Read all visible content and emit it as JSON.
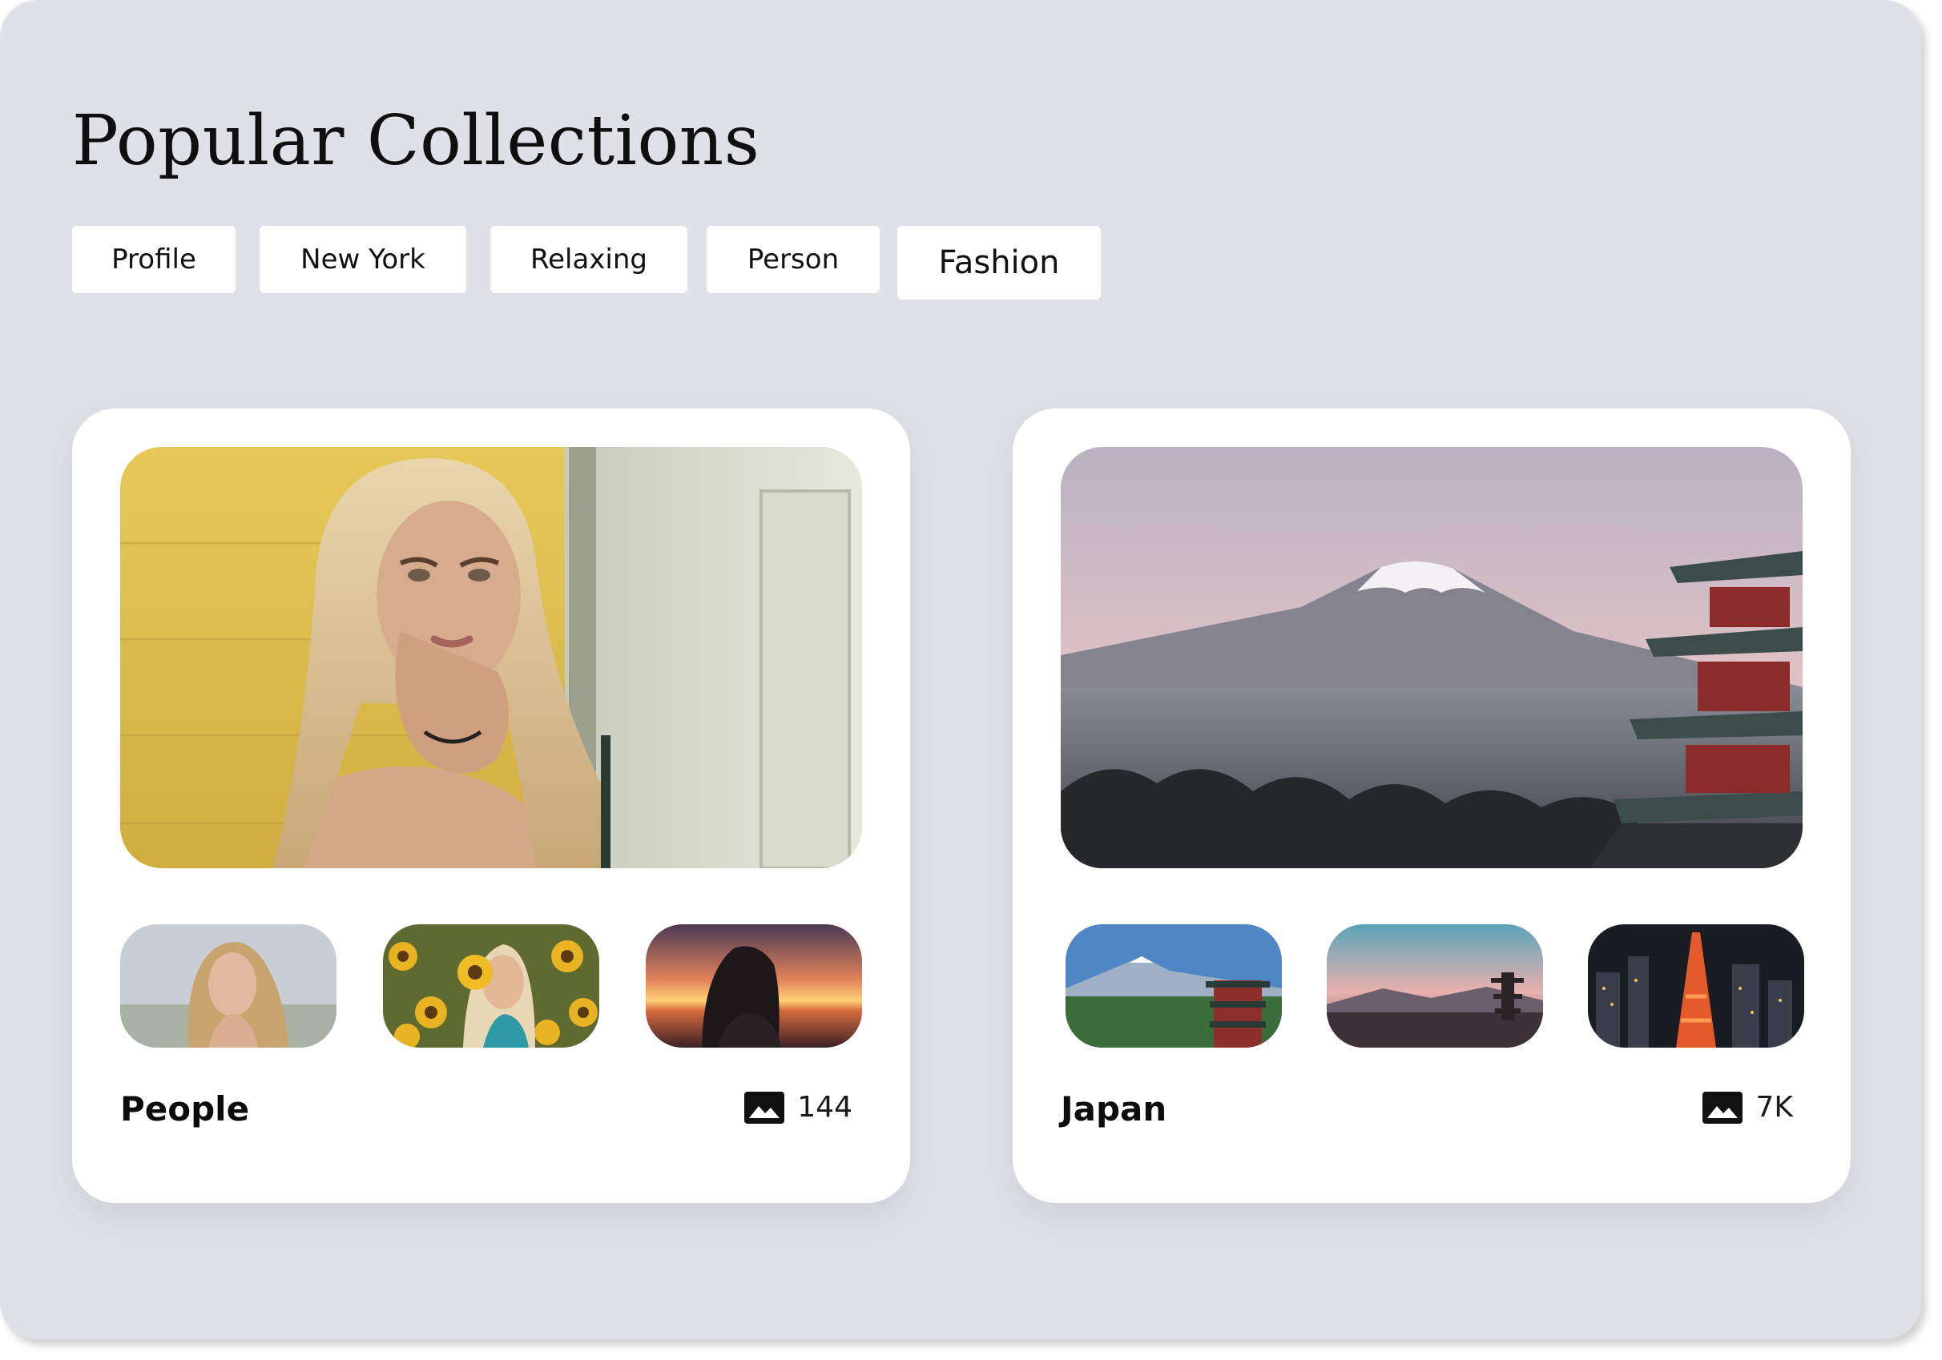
{
  "page": {
    "title": "Popular Collections"
  },
  "filters": [
    {
      "label": "Profile"
    },
    {
      "label": "New York"
    },
    {
      "label": "Relaxing"
    },
    {
      "label": "Person"
    },
    {
      "label": "Fashion",
      "active": true
    }
  ],
  "collections": [
    {
      "name": "People",
      "count": "144",
      "count_icon": "image-icon",
      "hero": "portrait of blonde woman against yellow wall",
      "thumbs": [
        "woman portrait outdoors",
        "woman holding sunflower",
        "woman silhouette at sunset"
      ]
    },
    {
      "name": "Japan",
      "count": "7K",
      "count_icon": "image-icon",
      "hero": "mount fuji with pagoda over city",
      "thumbs": [
        "fuji and pagoda daytime",
        "pagoda at dusk",
        "tokyo tower night city"
      ]
    }
  ],
  "colors": {
    "background": "#dfe1e6",
    "card": "#ffffff",
    "text": "#0f0f0f"
  }
}
